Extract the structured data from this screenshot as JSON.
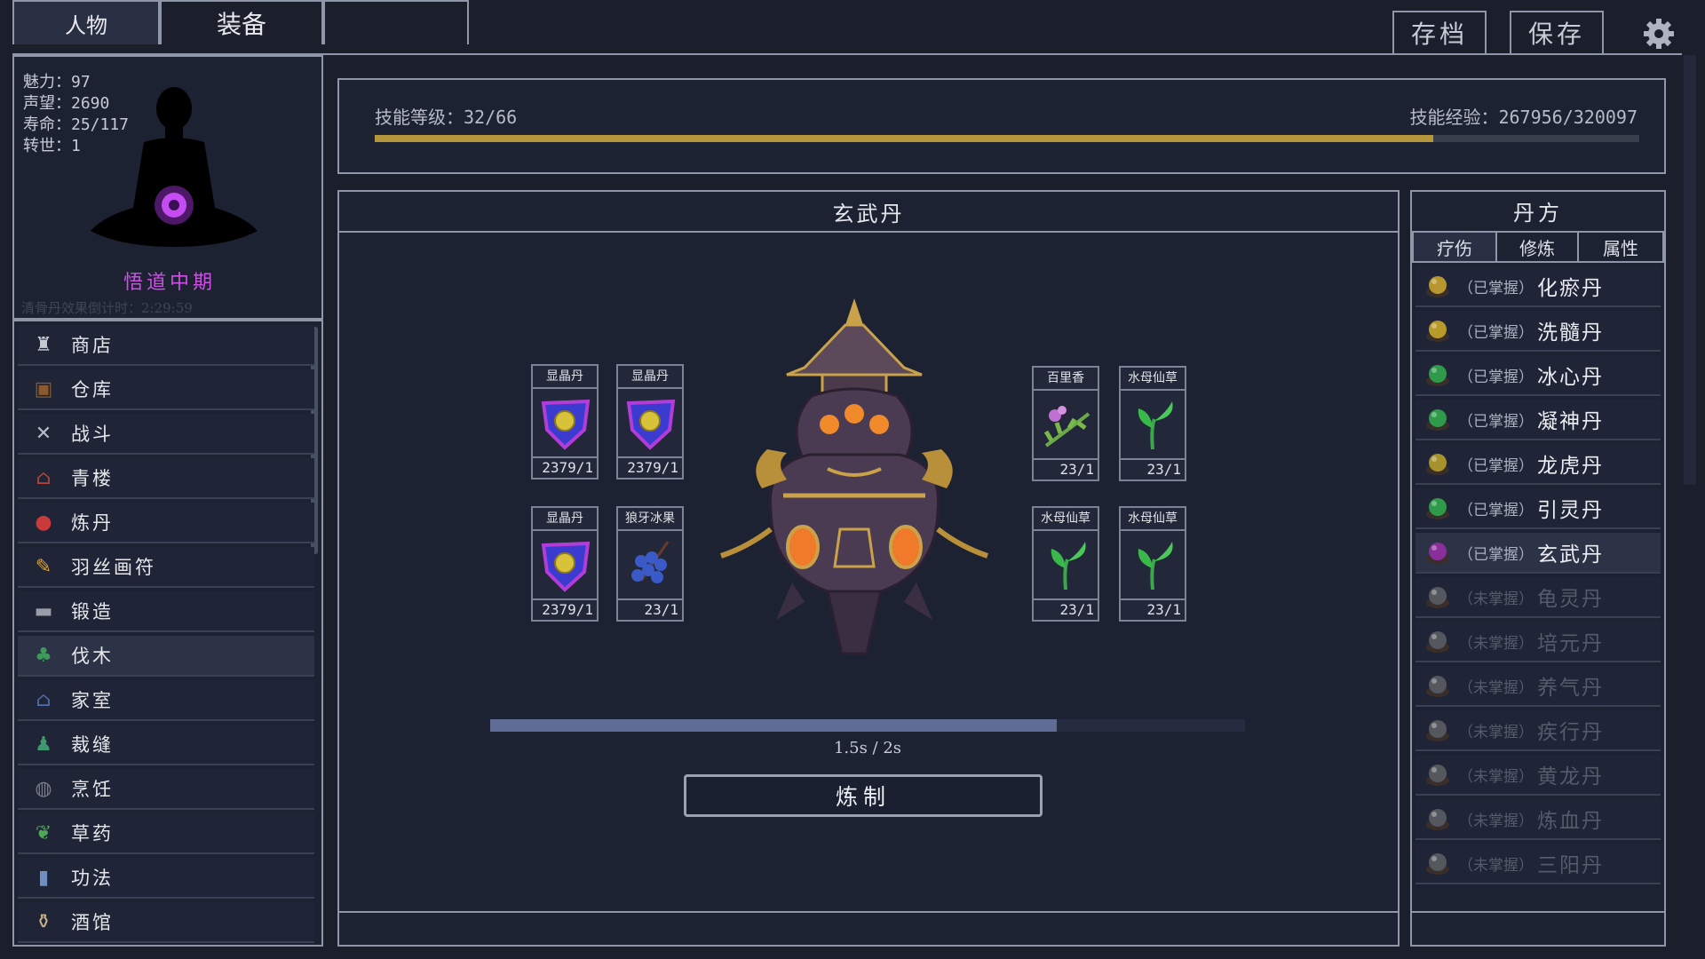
{
  "tabs": [
    {
      "label": "人物"
    },
    {
      "label": "装备"
    }
  ],
  "top_buttons": {
    "archive": "存档",
    "save": "保存"
  },
  "icons": {
    "settings": "gear-icon"
  },
  "profile": {
    "stats": [
      {
        "label": "魅力：97"
      },
      {
        "label": "声望：2690"
      },
      {
        "label": "寿命：25/117"
      },
      {
        "label": "转世：1"
      }
    ],
    "realm": "悟道中期",
    "timer": "清骨丹效果倒计时：2:29:59"
  },
  "menu": [
    {
      "label": "商店",
      "icon": "shop-icon",
      "color": "#c7c9d1"
    },
    {
      "label": "仓库",
      "icon": "chest-icon",
      "color": "#8a5a2c"
    },
    {
      "label": "战斗",
      "icon": "swords-icon",
      "color": "#b9bcc6"
    },
    {
      "label": "青楼",
      "icon": "pavilion-icon",
      "color": "#b5473b"
    },
    {
      "label": "炼丹",
      "icon": "pill-icon",
      "color": "#c93a3a"
    },
    {
      "label": "羽丝画符",
      "icon": "talisman-icon",
      "color": "#d9a33a"
    },
    {
      "label": "锻造",
      "icon": "anvil-icon",
      "color": "#9a9da8"
    },
    {
      "label": "伐木",
      "icon": "tree-icon",
      "color": "#3d9a5a"
    },
    {
      "label": "家室",
      "icon": "house-icon",
      "color": "#4f6fb0"
    },
    {
      "label": "裁缝",
      "icon": "robe-icon",
      "color": "#3e9a6e"
    },
    {
      "label": "烹饪",
      "icon": "pan-icon",
      "color": "#7a7d88"
    },
    {
      "label": "草药",
      "icon": "herb-icon",
      "color": "#4fa85a"
    },
    {
      "label": "功法",
      "icon": "scroll-icon",
      "color": "#6f8fc0"
    },
    {
      "label": "酒馆",
      "icon": "wine-icon",
      "color": "#c9b48a"
    }
  ],
  "skill": {
    "level_text": "技能等级：32/66",
    "exp_text": "技能经验：267956/320097",
    "progress": 0.837
  },
  "crafting": {
    "title": "玄武丹",
    "left_ingredients": [
      {
        "name": "显晶丹",
        "qty": "2379/1",
        "kind": "gem"
      },
      {
        "name": "显晶丹",
        "qty": "2379/1",
        "kind": "gem"
      },
      {
        "name": "显晶丹",
        "qty": "2379/1",
        "kind": "gem"
      },
      {
        "name": "狼牙冰果",
        "qty": "23/1",
        "kind": "berries"
      }
    ],
    "right_ingredients": [
      {
        "name": "百里香",
        "qty": "23/1",
        "kind": "flower"
      },
      {
        "name": "水母仙草",
        "qty": "23/1",
        "kind": "sprout"
      },
      {
        "name": "水母仙草",
        "qty": "23/1",
        "kind": "sprout"
      },
      {
        "name": "水母仙草",
        "qty": "23/1",
        "kind": "sprout"
      }
    ],
    "progress": 0.75,
    "time_text": "1.5s / 2s",
    "button": "炼制"
  },
  "recipes": {
    "title": "丹方",
    "tabs": [
      {
        "label": "疗伤"
      },
      {
        "label": "修炼"
      },
      {
        "label": "属性"
      }
    ],
    "items": [
      {
        "status": "（已掌握）",
        "name": "化瘀丹",
        "color": "#b8962e"
      },
      {
        "status": "（已掌握）",
        "name": "洗髓丹",
        "color": "#b89a2a"
      },
      {
        "status": "（已掌握）",
        "name": "冰心丹",
        "color": "#2f9a4a"
      },
      {
        "status": "（已掌握）",
        "name": "凝神丹",
        "color": "#2f9a4a"
      },
      {
        "status": "（已掌握）",
        "name": "龙虎丹",
        "color": "#a8922e"
      },
      {
        "status": "（已掌握）",
        "name": "引灵丹",
        "color": "#2f9a4a"
      },
      {
        "status": "（已掌握）",
        "name": "玄武丹",
        "color": "#8a2f9a"
      },
      {
        "status": "（未掌握）",
        "name": "龟灵丹",
        "color": "#55575e"
      },
      {
        "status": "（未掌握）",
        "name": "培元丹",
        "color": "#55575e"
      },
      {
        "status": "（未掌握）",
        "name": "养气丹",
        "color": "#55575e"
      },
      {
        "status": "（未掌握）",
        "name": "疾行丹",
        "color": "#55575e"
      },
      {
        "status": "（未掌握）",
        "name": "黄龙丹",
        "color": "#55575e"
      },
      {
        "status": "（未掌握）",
        "name": "炼血丹",
        "color": "#55575e"
      },
      {
        "status": "（未掌握）",
        "name": "三阳丹",
        "color": "#55575e"
      }
    ]
  }
}
